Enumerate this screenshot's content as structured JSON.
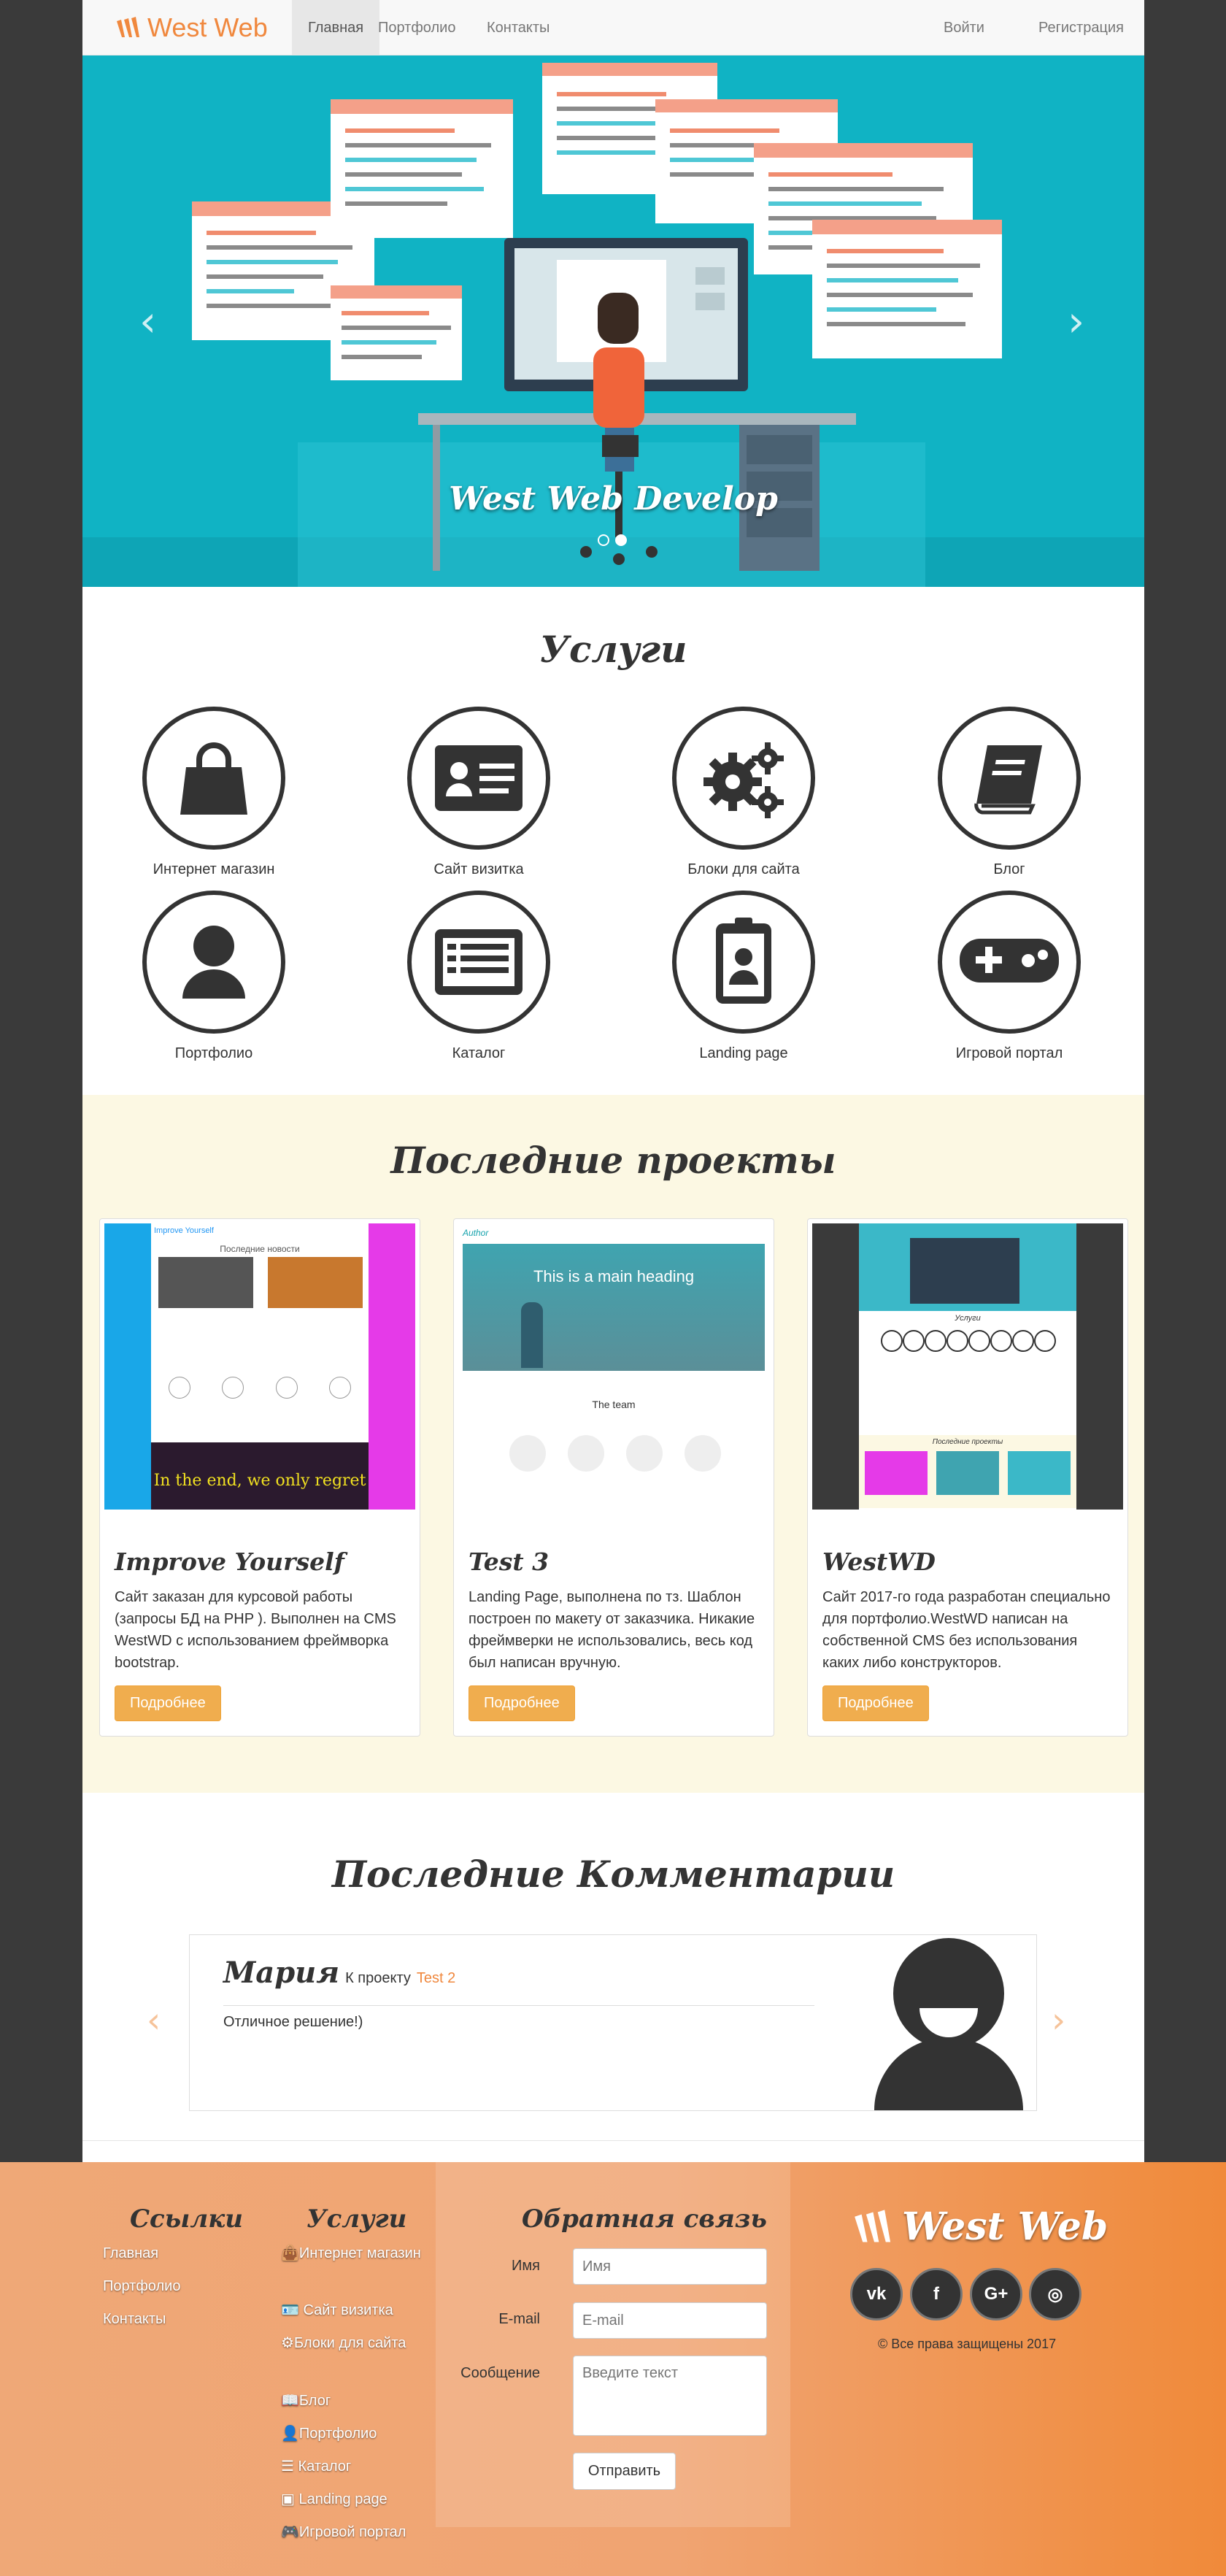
{
  "navbar": {
    "brand": "West Web",
    "items": [
      {
        "label": "Главная",
        "active": true
      },
      {
        "label": "Портфолио"
      },
      {
        "label": "Контакты"
      }
    ],
    "right": [
      {
        "label": "Войти"
      },
      {
        "label": "Регистрация"
      }
    ]
  },
  "carousel": {
    "caption": "West Web Develop",
    "prev": "‹",
    "next": "›",
    "active_slide": 2,
    "slide_count": 2
  },
  "services": {
    "title": "Услуги",
    "items": [
      {
        "label": "Интернет магазин",
        "icon": "shopping-bag-icon"
      },
      {
        "label": "Сайт визитка",
        "icon": "id-card-icon"
      },
      {
        "label": "Блоки для сайта",
        "icon": "gears-icon"
      },
      {
        "label": "Блог",
        "icon": "book-icon"
      },
      {
        "label": "Портфолио",
        "icon": "user-icon"
      },
      {
        "label": "Каталог",
        "icon": "list-icon"
      },
      {
        "label": "Landing page",
        "icon": "badge-icon"
      },
      {
        "label": "Игровой портал",
        "icon": "gamepad-icon"
      }
    ]
  },
  "projects": {
    "title": "Последние проекты",
    "cards": [
      {
        "title": "Improve Yourself",
        "text": "Сайт заказан для курсовой работы (запросы БД на PHP ). Выполнен на CMS WestWD с использованием фреймворка bootstrap.",
        "button": "Подробнее",
        "thumb_header": "Improve Yourself",
        "thumb_heading": "Последние новости",
        "thumb_quote": "In the end, we only regret"
      },
      {
        "title": "Test 3",
        "text": "Landing Page, выполнена по тз. Шаблон построен по макету от заказчика. Никакие фреймверки не использовались, весь код был написан вручную.",
        "button": "Подробнее",
        "thumb_header": "Author",
        "thumb_heading": "This is a main heading",
        "thumb_sub": "The team"
      },
      {
        "title": "WestWD",
        "text": "Сайт 2017-го года разработан специально для портфолио.WestWD написан на собственной CMS без использования каких либо конструкторов.",
        "button": "Подробнее",
        "thumb_heading": "Услуги",
        "thumb_sub": "Последние проекты"
      }
    ]
  },
  "comments": {
    "title": "Последние Комментарии",
    "author": "Мария",
    "to_project_prefix": "К проекту",
    "project_link": "Test 2",
    "text": "Отличное решение!)",
    "prev": "‹",
    "next": "›"
  },
  "footer": {
    "links_title": "Ссылки",
    "links": [
      "Главная",
      "Портфолио",
      "Контакты"
    ],
    "services_title": "Услуги",
    "services": [
      {
        "icon": "shopping-bag-icon",
        "label": "Интернет магазин"
      },
      {
        "icon": "id-card-icon",
        "label": "Сайт визитка"
      },
      {
        "icon": "gears-icon",
        "label": "Блоки для сайта"
      },
      {
        "icon": "book-icon",
        "label": "Блог"
      },
      {
        "icon": "user-icon",
        "label": "Портфолио"
      },
      {
        "icon": "list-icon",
        "label": "Каталог"
      },
      {
        "icon": "badge-icon",
        "label": "Landing page"
      },
      {
        "icon": "gamepad-icon",
        "label": "Игровой портал"
      }
    ],
    "form": {
      "title": "Обратная связь",
      "name_label": "Имя",
      "name_placeholder": "Имя",
      "email_label": "E-mail",
      "email_placeholder": "E-mail",
      "message_label": "Сообщение",
      "message_placeholder": "Введите текст",
      "submit": "Отправить"
    },
    "brand": "West Web",
    "social": [
      {
        "icon": "vk-icon",
        "glyph": "vk"
      },
      {
        "icon": "facebook-icon",
        "glyph": "f"
      },
      {
        "icon": "google-plus-icon",
        "glyph": "G+"
      },
      {
        "icon": "instagram-icon",
        "glyph": "◎"
      }
    ],
    "copyright": "© Все права защищены 2017"
  },
  "colors": {
    "accent": "#f0883e",
    "button": "#f0ad4e",
    "carousel_bg": "#10b3c4",
    "projects_bg": "#fcf8e3",
    "sidebar_bg": "#3a3a3a"
  }
}
